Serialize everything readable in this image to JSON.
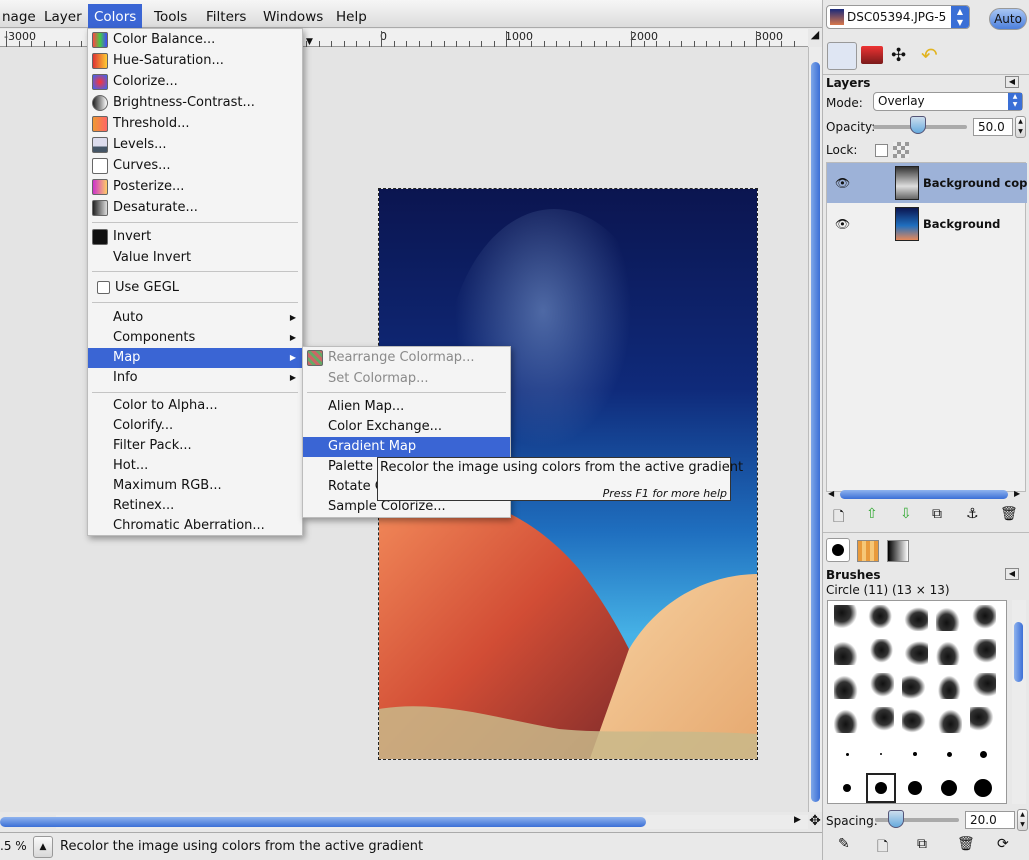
{
  "menubar": {
    "items": [
      "nage",
      "Layer",
      "Colors",
      "Tools",
      "Filters",
      "Windows",
      "Help"
    ]
  },
  "ruler": {
    "labels": [
      "-3000",
      "1000",
      "0",
      "1000",
      "2000",
      "3000"
    ]
  },
  "colors_menu": {
    "group1": [
      "Color Balance...",
      "Hue-Saturation...",
      "Colorize...",
      "Brightness-Contrast...",
      "Threshold...",
      "Levels...",
      "Curves...",
      "Posterize...",
      "Desaturate..."
    ],
    "group2": [
      "Invert",
      "Value Invert"
    ],
    "use_gegl": "Use GEGL",
    "group3": [
      "Auto",
      "Components",
      "Map",
      "Info"
    ],
    "group4": [
      "Color to Alpha...",
      "Colorify...",
      "Filter Pack...",
      "Hot...",
      "Maximum RGB...",
      "Retinex...",
      "Chromatic Aberration..."
    ]
  },
  "map_menu": {
    "disabled": [
      "Rearrange Colormap...",
      "Set Colormap..."
    ],
    "items": [
      "Alien Map...",
      "Color Exchange...",
      "Gradient Map",
      "Palette Map...",
      "Rotate Colors...",
      "Sample Colorize..."
    ],
    "visible_labels": [
      "Palette M",
      "Rotate C",
      "Sample Colorize..."
    ]
  },
  "tooltip": {
    "text": "Recolor the image using colors from the active gradient",
    "help": "Press F1 for more help"
  },
  "image_select": {
    "value": "DSC05394.JPG-5",
    "auto": "Auto"
  },
  "layers": {
    "title": "Layers",
    "mode_label": "Mode:",
    "mode_value": "Overlay",
    "opacity_label": "Opacity:",
    "opacity_value": "50.0",
    "opacity_fraction": 0.5,
    "lock_label": "Lock:",
    "list": [
      "Background copy",
      "Background"
    ]
  },
  "brushes": {
    "title": "Brushes",
    "current": "Circle (11) (13 × 13)",
    "spacing_label": "Spacing:",
    "spacing_value": "20.0"
  },
  "status": {
    "zoom": ".5 %",
    "message": "Recolor the image using colors from the active gradient"
  }
}
